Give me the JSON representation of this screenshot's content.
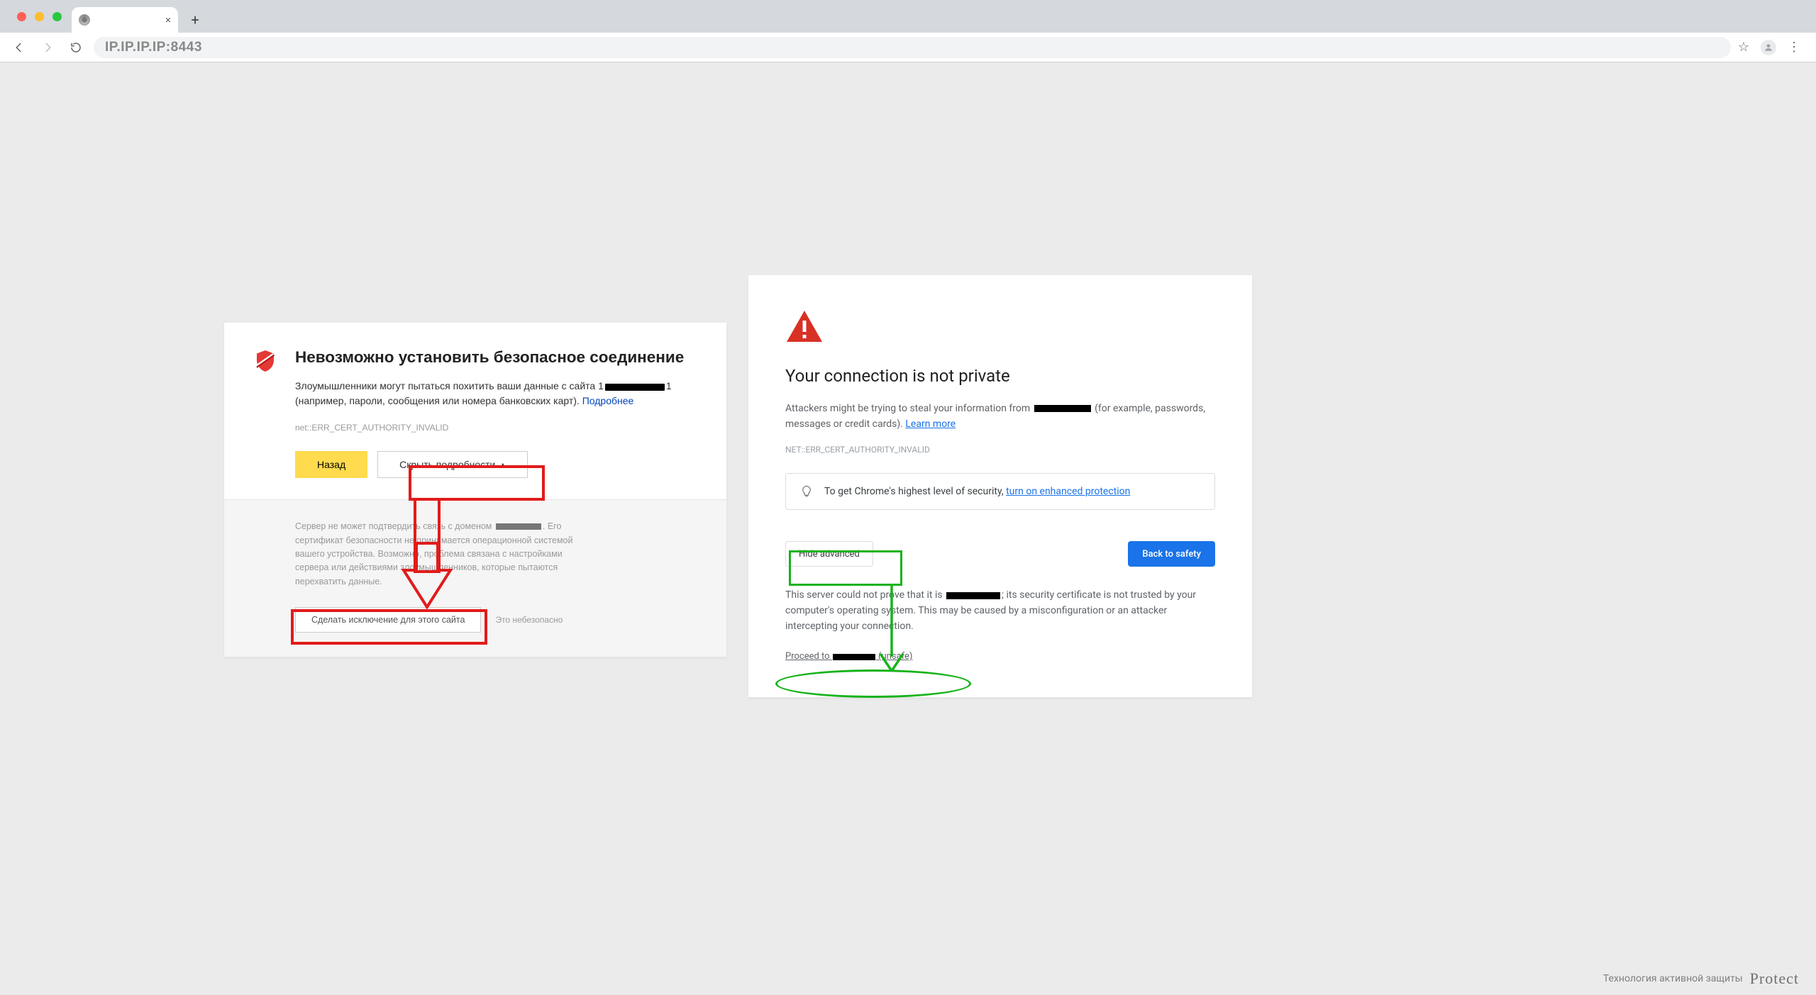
{
  "browser": {
    "address": "IP.IP.IP.IP:8443",
    "tab_title": ""
  },
  "yandex": {
    "title": "Невозможно установить безопасное соединение",
    "desc_pre": "Злоумышленники могут пытаться похитить ваши данные с сайта ",
    "desc_post": " (например, пароли, сообщения или номера банковских карт). ",
    "more_link": "Подробнее",
    "error_code": "net::ERR_CERT_AUTHORITY_INVALID",
    "back_btn": "Назад",
    "hide_details_btn": "Скрыть подробности",
    "details_text_a": "Сервер не может подтвердить связь с доменом ",
    "details_text_b": ". Его сертификат безопасности не принимается операционной системой вашего устройства. Возможно, проблема связана с настройками сервера или действиями злоумышленников, которые пытаются перехватить данные.",
    "exception_btn": "Сделать исключение для этого сайта",
    "exception_note": "Это небезопасно"
  },
  "chrome": {
    "title": "Your connection is not private",
    "desc_pre": "Attackers might be trying to steal your information from ",
    "desc_post": " (for example, passwords, messages or credit cards). ",
    "learn_more": "Learn more",
    "error_code": "NET::ERR_CERT_AUTHORITY_INVALID",
    "banner_text": "To get Chrome's highest level of security, ",
    "banner_link": "turn on enhanced protection",
    "hide_advanced": "Hide advanced",
    "back_safety": "Back to safety",
    "detail_pre": "This server could not prove that it is ",
    "detail_post": "; its security certificate is not trusted by your computer's operating system. This may be caused by a misconfiguration or an attacker intercepting your connection.",
    "proceed_pre": "Proceed to ",
    "proceed_post": " (unsafe)"
  },
  "footer": {
    "text": "Технология активной защиты",
    "brand": "Protect"
  }
}
